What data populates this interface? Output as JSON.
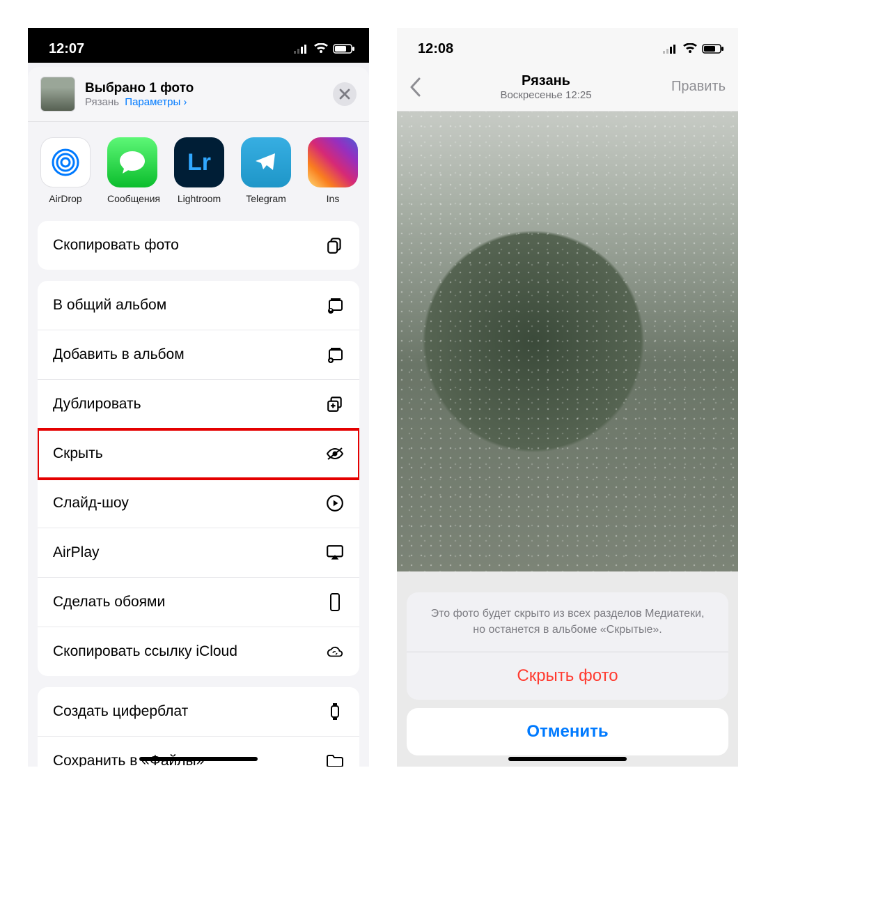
{
  "left": {
    "status": {
      "time": "12:07"
    },
    "header": {
      "title": "Выбрано 1 фото",
      "location": "Рязань",
      "options": "Параметры"
    },
    "apps": [
      {
        "label": "AirDrop"
      },
      {
        "label": "Сообщения"
      },
      {
        "label": "Lightroom"
      },
      {
        "label": "Telegram"
      },
      {
        "label": "Ins"
      }
    ],
    "groups": [
      {
        "items": [
          {
            "label": "Скопировать фото",
            "icon": "copy"
          }
        ]
      },
      {
        "items": [
          {
            "label": "В общий альбом",
            "icon": "shared-album"
          },
          {
            "label": "Добавить в альбом",
            "icon": "add-album"
          },
          {
            "label": "Дублировать",
            "icon": "duplicate"
          },
          {
            "label": "Скрыть",
            "icon": "hide",
            "highlight": true
          },
          {
            "label": "Слайд-шоу",
            "icon": "play"
          },
          {
            "label": "AirPlay",
            "icon": "airplay"
          },
          {
            "label": "Сделать обоями",
            "icon": "phone"
          },
          {
            "label": "Скопировать ссылку iCloud",
            "icon": "cloud-link"
          }
        ]
      },
      {
        "items": [
          {
            "label": "Создать циферблат",
            "icon": "watch"
          },
          {
            "label": "Сохранить в «Файлы»",
            "icon": "folder"
          }
        ]
      }
    ]
  },
  "right": {
    "status": {
      "time": "12:08"
    },
    "nav": {
      "title": "Рязань",
      "subtitle": "Воскресенье 12:25",
      "edit": "Править"
    },
    "sheet": {
      "message": "Это фото будет скрыто из всех разделов Медиатеки, но останется в альбоме «Скрытые».",
      "hide": "Скрыть фото",
      "cancel": "Отменить"
    }
  }
}
